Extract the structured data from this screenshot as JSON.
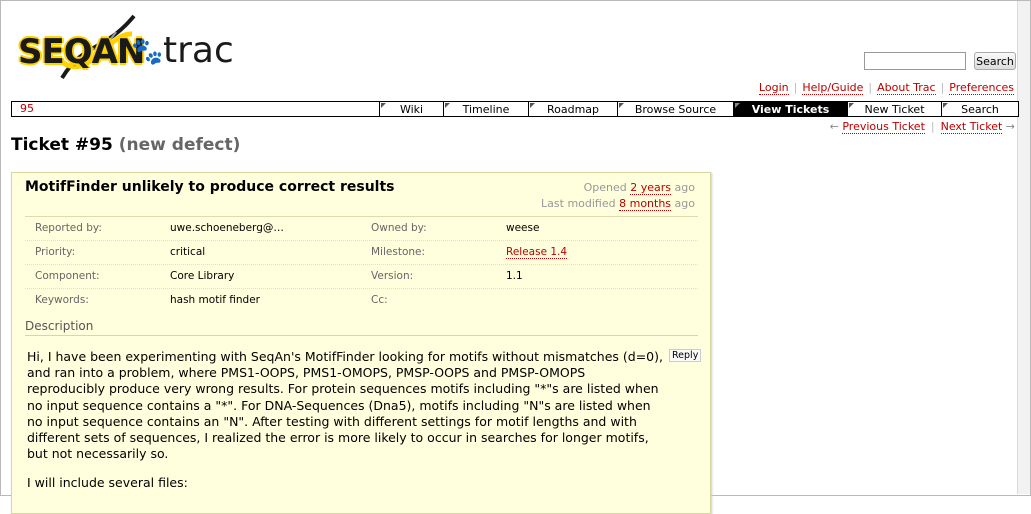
{
  "logo": {
    "left_text": "SEQAN",
    "right_text": "trac"
  },
  "search": {
    "placeholder": "",
    "button_label": "Search"
  },
  "metanav": {
    "login": "Login",
    "help": "Help/Guide",
    "about": "About Trac",
    "preferences": "Preferences"
  },
  "mainnav": {
    "context": "95",
    "items": [
      {
        "label": "Wiki"
      },
      {
        "label": "Timeline"
      },
      {
        "label": "Roadmap"
      },
      {
        "label": "Browse Source"
      },
      {
        "label": "View Tickets",
        "active": true
      },
      {
        "label": "New Ticket"
      },
      {
        "label": "Search"
      }
    ]
  },
  "ticketnav": {
    "prev_arrow": "←",
    "prev": "Previous Ticket",
    "next": "Next Ticket",
    "next_arrow": "→"
  },
  "title": {
    "text": "Ticket #95",
    "status": "(new defect)"
  },
  "ticket": {
    "summary": "MotifFinder unlikely to produce correct results",
    "opened_prefix": "Opened",
    "opened_link": "2 years",
    "opened_suffix": "ago",
    "modified_prefix": "Last modified",
    "modified_link": "8 months",
    "modified_suffix": "ago",
    "props": [
      {
        "label1": "Reported by:",
        "value1": "uwe.schoeneberg@…",
        "label2": "Owned by:",
        "value2": "weese"
      },
      {
        "label1": "Priority:",
        "value1": "critical",
        "label2": "Milestone:",
        "value2": "Release 1.4"
      },
      {
        "label1": "Component:",
        "value1": "Core Library",
        "label2": "Version:",
        "value2": "1.1"
      },
      {
        "label1": "Keywords:",
        "value1": "hash motif finder",
        "label2": "Cc:",
        "value2": ""
      }
    ],
    "description_heading": "Description",
    "reply_label": "Reply",
    "description_p1": "Hi, I have been experimenting with SeqAn's MotifFinder looking for motifs without mismatches (d=0), and ran into a problem, where PMS1-OOPS, PMS1-OMOPS, PMSP-OOPS and PMSP-OMOPS reproducibly produce very wrong results. For protein sequences motifs including \"*\"s are listed when no input sequence contains a \"*\". For DNA-Sequences (Dna5), motifs including \"N\"s are listed when no input sequence contains an \"N\". After testing with different settings for motif lengths and with different sets of sequences, I realized the error is more likely to occur in searches for longer motifs, but not necessarily so.",
    "description_p2": "I will include several files:"
  },
  "colors": {
    "link": "#bb0000",
    "ticket_bg": "#ffffdd",
    "active_tab_bg": "#000000"
  }
}
